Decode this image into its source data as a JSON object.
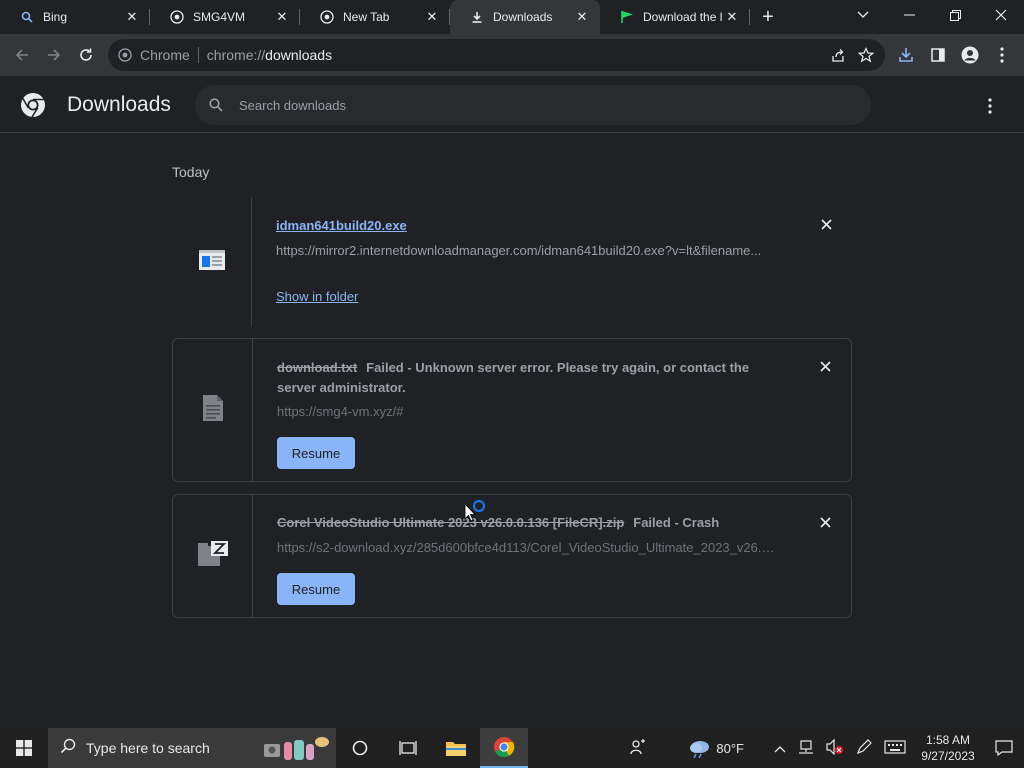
{
  "tabs": [
    {
      "title": "Bing",
      "icon": "bing-search-icon",
      "active": false
    },
    {
      "title": "SMG4VM",
      "icon": "globe-icon",
      "active": false
    },
    {
      "title": "New Tab",
      "icon": "chrome-icon",
      "active": false
    },
    {
      "title": "Downloads",
      "icon": "download-icon",
      "active": true
    },
    {
      "title": "Download the l",
      "icon": "flag-icon",
      "active": false
    }
  ],
  "omnibox": {
    "chip": "Chrome",
    "scheme": "chrome://",
    "path": "downloads"
  },
  "header": {
    "title": "Downloads",
    "search_placeholder": "Search downloads"
  },
  "section_label": "Today",
  "downloads": [
    {
      "file_name": "idman641build20.exe",
      "url": "https://mirror2.internetdownloadmanager.com/idman641build20.exe?v=lt&filename...",
      "action": "Show in folder"
    },
    {
      "file_name": "download.txt",
      "status": "Failed - Unknown server error. Please try again, or contact the server administrator.",
      "url": "https://smg4-vm.xyz/#",
      "action": "Resume"
    },
    {
      "file_name": "Corel VideoStudio Ultimate 2023 v26.0.0.136 [FileCR].zip",
      "status": "Failed - Crash",
      "url": "https://s2-download.xyz/285d600bfce4d113/Corel_VideoStudio_Ultimate_2023_v26.0...",
      "action": "Resume"
    }
  ],
  "taskbar": {
    "search_placeholder": "Type here to search",
    "weather": "80°F",
    "time": "1:58 AM",
    "date": "9/27/2023"
  },
  "colors": {
    "accent": "#8ab4f8",
    "background": "#202124",
    "toolbar": "#35363a"
  }
}
